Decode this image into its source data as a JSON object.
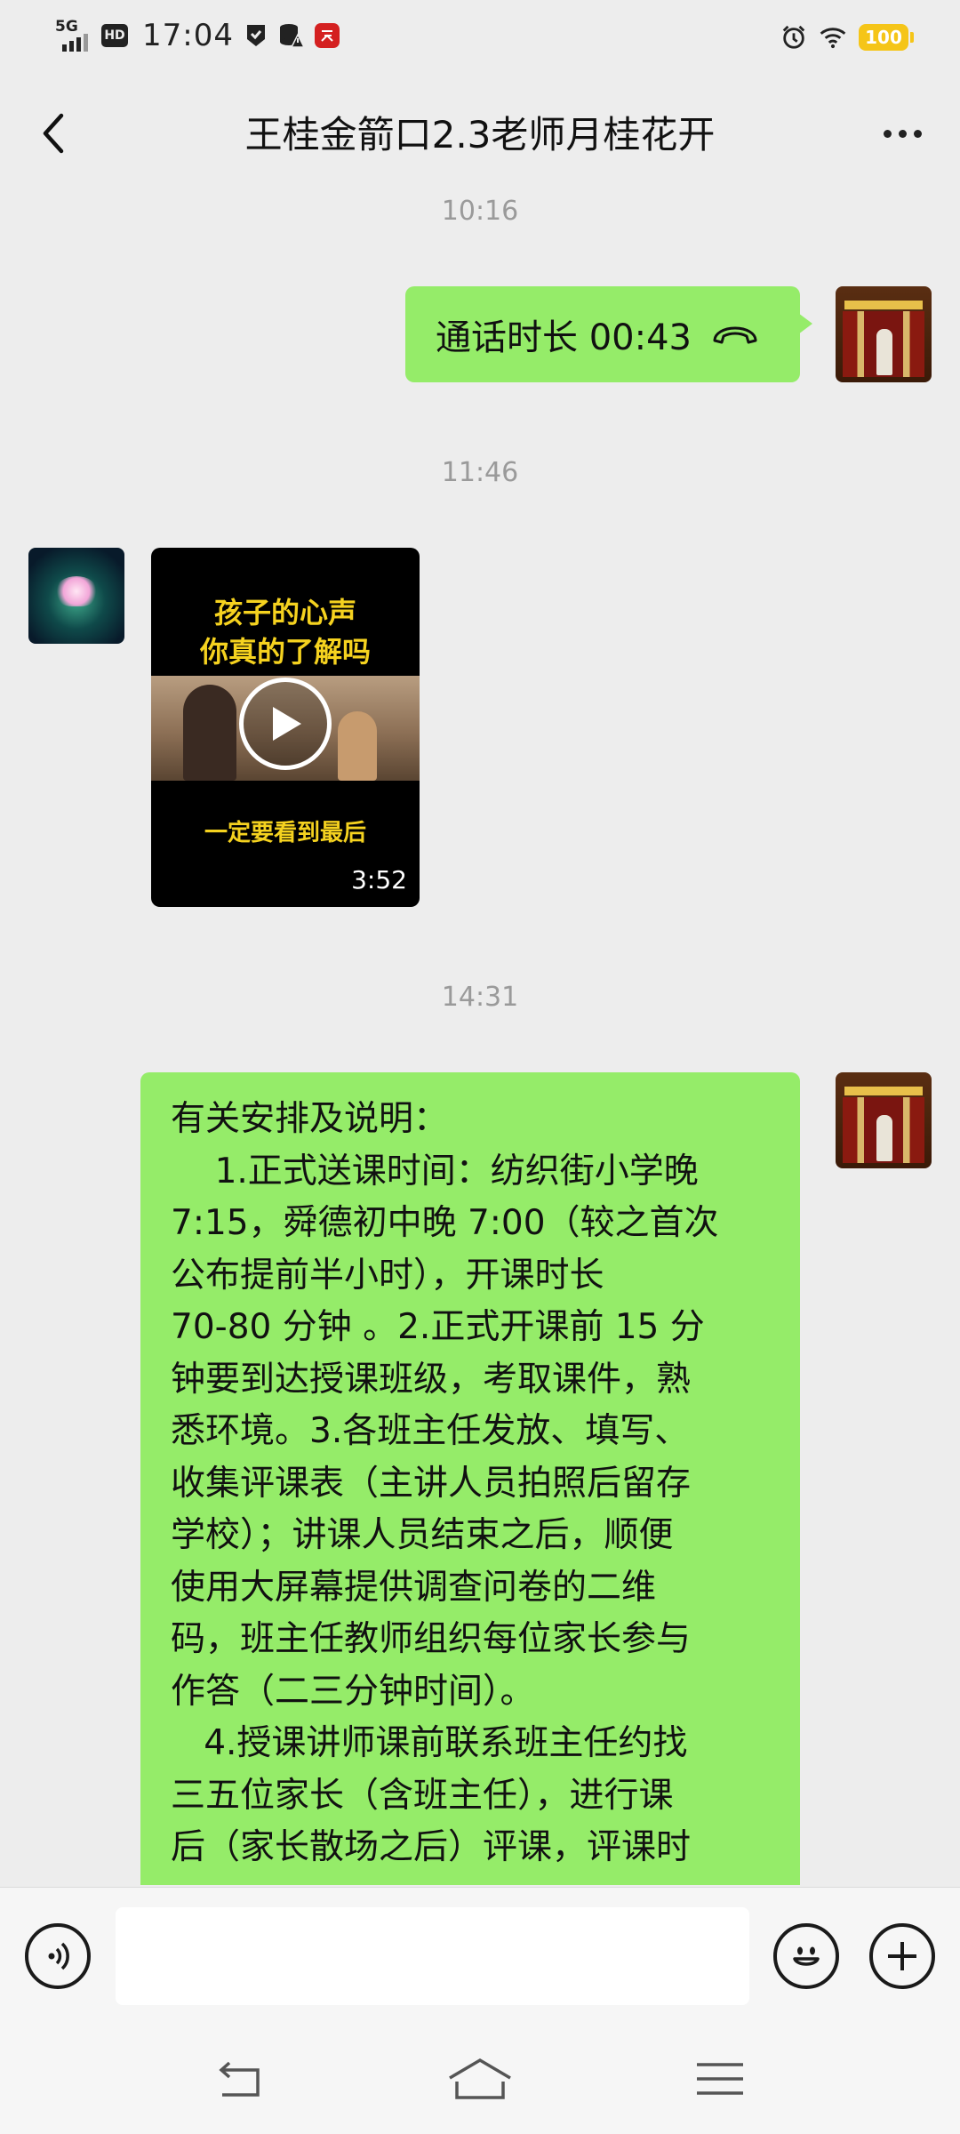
{
  "status_bar": {
    "network": "5G",
    "hd": "HD",
    "time": "17:04",
    "battery": "100"
  },
  "header": {
    "title": "王桂金箭口2.3老师月桂花开"
  },
  "messages": {
    "ts1": "10:16",
    "call_text": "通话时长 00:43",
    "ts2": "11:46",
    "video": {
      "title_line1": "孩子的心声",
      "title_line2": "你真的了解吗",
      "caption": "一定要看到最后",
      "duration": "3:52"
    },
    "ts3": "14:31",
    "text_lines": [
      "有关安排及说明：",
      "    1.正式送课时间：纺织街小学晚",
      "7:15，舜德初中晚 7:00（较之首次",
      "公布提前半小时），开课时长",
      "70-80 分钟 。2.正式开课前 15 分",
      "钟要到达授课班级，考取课件，熟",
      "悉环境。3.各班主任发放、填写、",
      "收集评课表（主讲人员拍照后留存",
      "学校）；讲课人员结束之后，顺便",
      "使用大屏幕提供调查问卷的二维",
      "码，班主任教师组织每位家长参与",
      "作答（二三分钟时间）。",
      "   4.授课讲师课前联系班主任约找",
      "三五位家长（含班主任），进行课",
      "后（家长散场之后）评课，评课时"
    ]
  },
  "input": {
    "value": "",
    "placeholder": ""
  },
  "colors": {
    "chat_bg": "#ededed",
    "bubble_green": "#95ec69",
    "timestamp": "#9a9a9a",
    "video_title": "#f5d21f",
    "battery": "#f5c518"
  }
}
